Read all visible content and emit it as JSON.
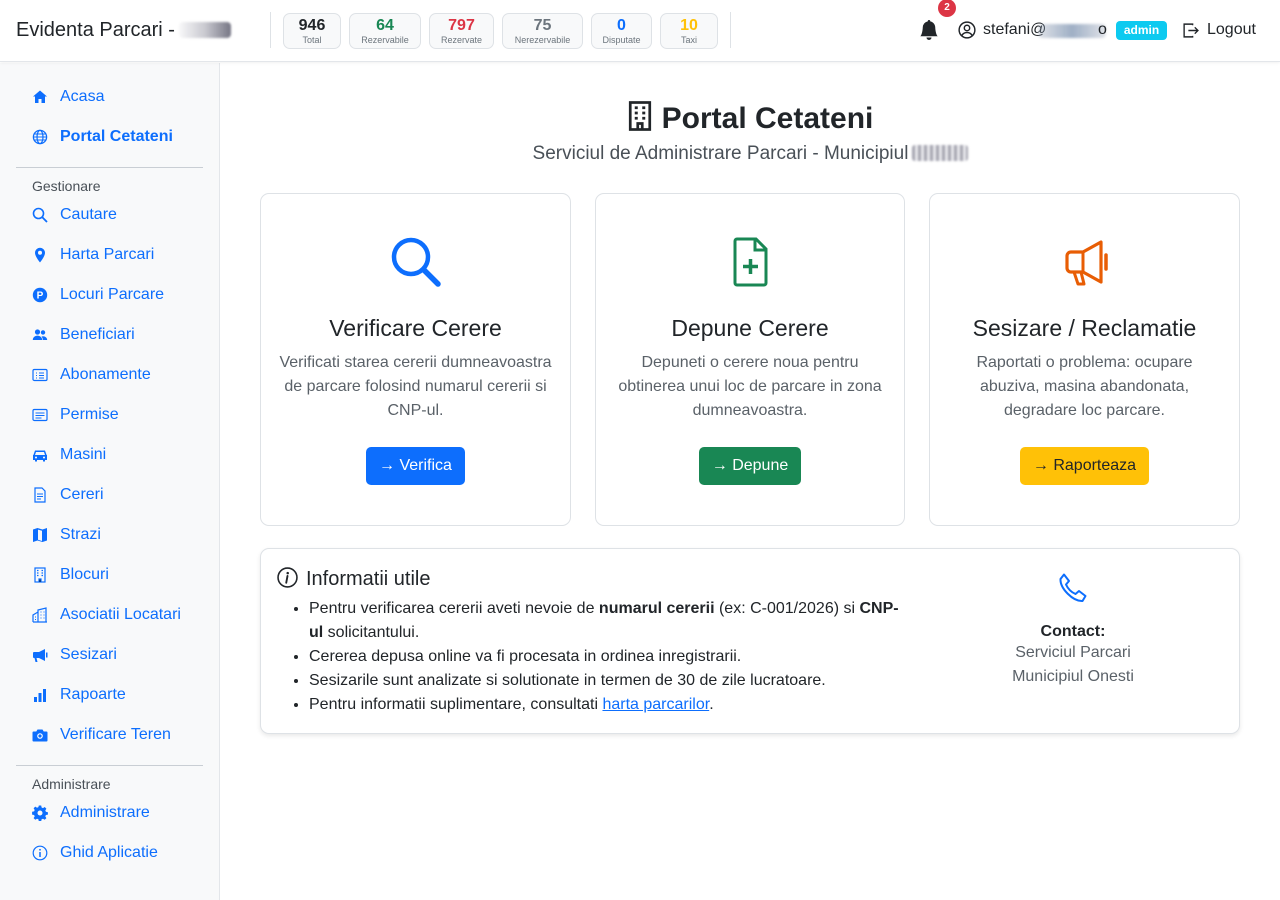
{
  "header": {
    "brand": "Evidenta Parcari -",
    "stats": [
      {
        "value": "946",
        "label": "Total",
        "color": "#212529"
      },
      {
        "value": "64",
        "label": "Rezervabile",
        "color": "#198754"
      },
      {
        "value": "797",
        "label": "Rezervate",
        "color": "#dc3545"
      },
      {
        "value": "75",
        "label": "Nerezervabile",
        "color": "#6c757d"
      },
      {
        "value": "0",
        "label": "Disputate",
        "color": "#0d6efd"
      },
      {
        "value": "10",
        "label": "Taxi",
        "color": "#ffc107"
      }
    ],
    "notification_count": "2",
    "user_name_start": "stefani@",
    "user_name_end": "o",
    "role": "admin",
    "logout_label": "Logout"
  },
  "sidebar": {
    "items_top": [
      {
        "label": "Acasa",
        "icon": "house-icon"
      },
      {
        "label": "Portal Cetateni",
        "icon": "globe-icon",
        "active": true
      }
    ],
    "section_gestionare": "Gestionare",
    "items_gestionare": [
      {
        "label": "Cautare",
        "icon": "search-icon"
      },
      {
        "label": "Harta Parcari",
        "icon": "map-pin-icon"
      },
      {
        "label": "Locuri Parcare",
        "icon": "parking-icon"
      },
      {
        "label": "Beneficiari",
        "icon": "people-icon"
      },
      {
        "label": "Abonamente",
        "icon": "card-list-icon"
      },
      {
        "label": "Permise",
        "icon": "card-text-icon"
      },
      {
        "label": "Masini",
        "icon": "car-icon"
      },
      {
        "label": "Cereri",
        "icon": "document-icon"
      },
      {
        "label": "Strazi",
        "icon": "map-icon"
      },
      {
        "label": "Blocuri",
        "icon": "building-icon"
      },
      {
        "label": "Asociatii Locatari",
        "icon": "buildings-icon"
      },
      {
        "label": "Sesizari",
        "icon": "megaphone-icon"
      },
      {
        "label": "Rapoarte",
        "icon": "bar-chart-icon"
      },
      {
        "label": "Verificare Teren",
        "icon": "camera-icon"
      }
    ],
    "section_administrare": "Administrare",
    "items_administrare": [
      {
        "label": "Administrare",
        "icon": "gear-icon"
      },
      {
        "label": "Ghid Aplicatie",
        "icon": "info-icon"
      }
    ]
  },
  "main": {
    "title": "Portal Cetateni",
    "subtitle": "Serviciul de Administrare Parcari - Municipiul",
    "cards": [
      {
        "title": "Verificare Cerere",
        "text": "Verificati starea cererii dumneavoastra de parcare folosind numarul cererii si CNP-ul.",
        "button": "→ Verifica",
        "icon": "search-icon",
        "color": "#0d6efd"
      },
      {
        "title": "Depune Cerere",
        "text": "Depuneti o cerere noua pentru obtinerea unui loc de parcare in zona dumneavoastra.",
        "button": "→ Depune",
        "icon": "file-plus-icon",
        "color": "#198754"
      },
      {
        "title": "Sesizare / Reclamatie",
        "text": "Raportati o problema: ocupare abuziva, masina abandonata, degradare loc parcare.",
        "button": "→ Raporteaza",
        "icon": "megaphone-icon",
        "color": "#ffc107"
      }
    ],
    "info": {
      "title": "Informatii utile",
      "item1_pre": "Pentru verificarea cererii aveti nevoie de ",
      "item1_bold1": "numarul cererii",
      "item1_mid": " (ex: C-001/2026) si ",
      "item1_bold2": "CNP-ul",
      "item1_post": " solicitantului.",
      "item2": "Cererea depusa online va fi procesata in ordinea inregistrarii.",
      "item3": "Sesizarile sunt analizate si solutionate in termen de 30 de zile lucratoare.",
      "item4_pre": "Pentru informatii suplimentare, consultati ",
      "item4_link": "harta parcarilor",
      "item4_post": ".",
      "contact_title": "Contact:",
      "contact_line1": "Serviciul Parcari",
      "contact_line2": "Municipiul Onesti"
    }
  }
}
